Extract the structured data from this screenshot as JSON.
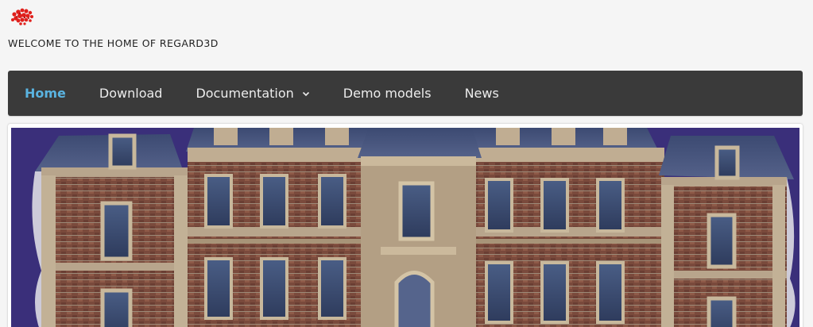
{
  "site": {
    "tagline": "WELCOME TO THE HOME OF REGARD3D"
  },
  "nav": {
    "items": [
      {
        "label": "Home",
        "active": true
      },
      {
        "label": "Download",
        "active": false
      },
      {
        "label": "Documentation",
        "active": false,
        "has_dropdown": true
      },
      {
        "label": "Demo models",
        "active": false
      },
      {
        "label": "News",
        "active": false
      }
    ]
  },
  "colors": {
    "accent": "#5ab3e0",
    "navbar": "#3a3a3a",
    "background": "#f5f5f5",
    "hero_sky": "#3a2f7a"
  },
  "icons": {
    "logo": "point-cloud-logo-icon",
    "dropdown": "chevron-down-icon"
  }
}
